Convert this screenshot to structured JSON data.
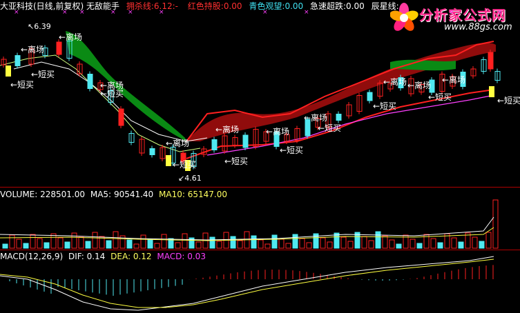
{
  "colors": {
    "bg": "#000000",
    "red": "#ff2020",
    "cyan": "#4fe8f0",
    "yellow": "#ffff40",
    "magenta": "#ff40ff",
    "white": "#ffffff",
    "green_cloud": "#0a8a14",
    "red_cloud": "#c01010",
    "grid": "#a00000"
  },
  "header": {
    "title": "大亚科技(日线,前复权) 无敌能手",
    "items": [
      {
        "label": "拥杀线:",
        "value": "6.12",
        "tail": ":-",
        "color": "#ff3030"
      },
      {
        "label": "红色持股:",
        "value": "0.00",
        "color": "#ff3030"
      },
      {
        "label": "青色观望:",
        "value": "0.00",
        "color": "#40e0f0"
      },
      {
        "label": "急速超跌:",
        "value": "0.00",
        "color": "#ffffff"
      },
      {
        "label": "辰星线:",
        "value": "",
        "color": "#ffffff"
      }
    ]
  },
  "logo": {
    "title": "分析家公式网",
    "url": "www.88gs.com"
  },
  "price_labels": {
    "high": "6.39",
    "low": "4.61"
  },
  "annotations": {
    "leave": "离场",
    "buy": "短买",
    "buy_arrow": "←短买",
    "leave_arrow": "←离场"
  },
  "volume_panel": {
    "label": "VOLUME:",
    "volume": "228501.00",
    "ma5_label": "MA5:",
    "ma5": "90541.40",
    "ma10_label": "MA10:",
    "ma10": "65147.00"
  },
  "macd_panel": {
    "label": "MACD(12,26,9)",
    "dif_label": "DIF:",
    "dif": "0.14",
    "dea_label": "DEA:",
    "dea": "0.12",
    "macd_label": "MACD:",
    "macd": "0.03"
  }
}
